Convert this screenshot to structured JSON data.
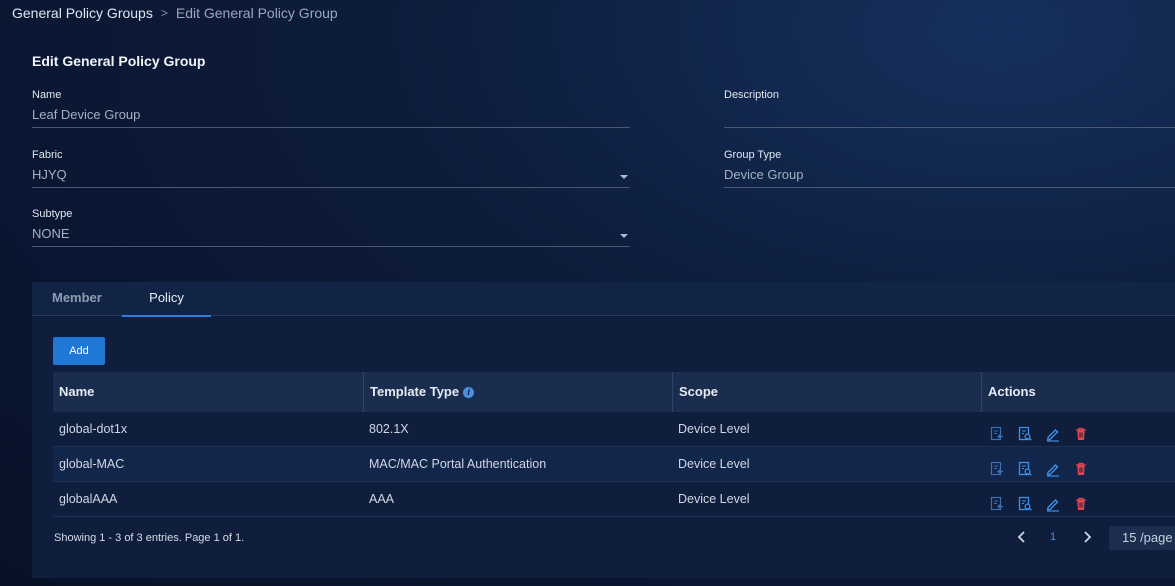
{
  "breadcrumb": {
    "parent": "General Policy Groups",
    "separator": ">",
    "current": "Edit General Policy Group"
  },
  "form": {
    "title": "Edit General Policy Group",
    "name": {
      "label": "Name",
      "value": "Leaf Device Group"
    },
    "description": {
      "label": "Description",
      "value": ""
    },
    "fabric": {
      "label": "Fabric",
      "value": "HJYQ"
    },
    "group_type": {
      "label": "Group Type",
      "value": "Device Group"
    },
    "subtype": {
      "label": "Subtype",
      "value": "NONE"
    }
  },
  "tabs": {
    "member": "Member",
    "policy": "Policy",
    "active": "Policy"
  },
  "add_label": "Add",
  "table": {
    "headers": {
      "name": "Name",
      "template_type": "Template Type",
      "scope": "Scope",
      "actions": "Actions"
    },
    "info_glyph": "i",
    "rows": [
      {
        "name": "global-dot1x",
        "template_type": "802.1X",
        "scope": "Device Level"
      },
      {
        "name": "global-MAC",
        "template_type": "MAC/MAC Portal Authentication",
        "scope": "Device Level"
      },
      {
        "name": "globalAAA",
        "template_type": "AAA",
        "scope": "Device Level"
      }
    ],
    "action_icons": [
      "apply-icon",
      "view-icon",
      "edit-icon",
      "delete-icon"
    ]
  },
  "pagination": {
    "summary": "Showing 1 - 3 of 3 entries. Page 1 of 1.",
    "current_page": "1",
    "page_size": "15 /page"
  },
  "colors": {
    "accent": "#1f77d6",
    "danger": "#e0454f",
    "background": "#0a1631"
  }
}
